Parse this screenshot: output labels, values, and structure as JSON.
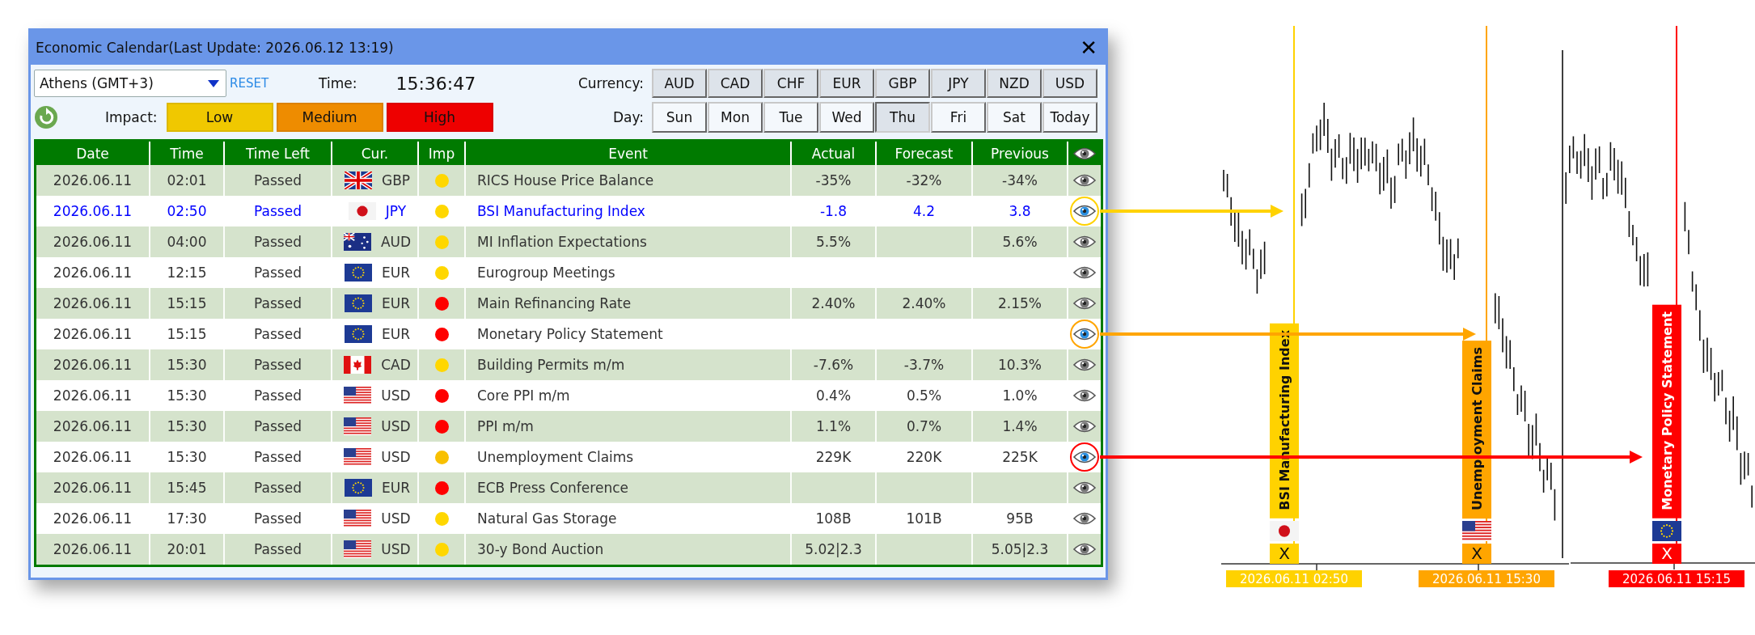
{
  "window": {
    "title": "Economic Calendar(Last Update: 2026.06.12 13:19)",
    "close": "✕"
  },
  "toolbar": {
    "timezone": "Athens (GMT+3)",
    "reset": "RESET",
    "time_label": "Time:",
    "time": "15:36:47",
    "currency_label": "Currency:",
    "currencies": [
      "AUD",
      "CAD",
      "CHF",
      "EUR",
      "GBP",
      "JPY",
      "NZD",
      "USD"
    ],
    "impact_label": "Impact:",
    "impacts": [
      {
        "label": "Low",
        "color": "#f0c800"
      },
      {
        "label": "Medium",
        "color": "#ee8c00"
      },
      {
        "label": "High",
        "color": "#ee0000"
      }
    ],
    "day_label": "Day:",
    "days": [
      {
        "label": "Sun",
        "selected": false
      },
      {
        "label": "Mon",
        "selected": false
      },
      {
        "label": "Tue",
        "selected": false
      },
      {
        "label": "Wed",
        "selected": false
      },
      {
        "label": "Thu",
        "selected": true
      },
      {
        "label": "Fri",
        "selected": false
      },
      {
        "label": "Sat",
        "selected": false
      },
      {
        "label": "Today",
        "selected": false
      }
    ]
  },
  "table": {
    "columns": [
      "Date",
      "Time",
      "Time Left",
      "Cur.",
      "Imp",
      "Event",
      "Actual",
      "Forecast",
      "Previous"
    ],
    "rows": [
      {
        "date": "2026.06.11",
        "time": "02:01",
        "time_left": "Passed",
        "flag": {
          "kind": "uk"
        },
        "currency": "GBP",
        "color": "#ffd700",
        "event": "RICS House Price Balance",
        "actual": "-35%",
        "forecast": "-32%",
        "previous": "-34%",
        "selected": false,
        "watched": false
      },
      {
        "date": "2026.06.11",
        "time": "02:50",
        "time_left": "Passed",
        "flag": {
          "kind": "jp"
        },
        "currency": "JPY",
        "color": "#ffd700",
        "event": "BSI Manufacturing Index",
        "actual": "-1.8",
        "forecast": "4.2",
        "previous": "3.8",
        "selected": true,
        "watched": true
      },
      {
        "date": "2026.06.11",
        "time": "04:00",
        "time_left": "Passed",
        "flag": {
          "kind": "au"
        },
        "currency": "AUD",
        "color": "#ffd700",
        "event": "MI Inflation Expectations",
        "actual": "5.5%",
        "previous": "5.6%",
        "selected": false,
        "watched": false
      },
      {
        "date": "2026.06.11",
        "time": "12:15",
        "time_left": "Passed",
        "flag": {
          "kind": "eu"
        },
        "currency": "EUR",
        "color": "#ffd700",
        "event": "Eurogroup Meetings",
        "selected": false,
        "watched": false
      },
      {
        "date": "2026.06.11",
        "time": "15:15",
        "time_left": "Passed",
        "flag": {
          "kind": "eu"
        },
        "currency": "EUR",
        "color": "#ff0000",
        "event": "Main Refinancing Rate",
        "actual": "2.40%",
        "forecast": "2.40%",
        "previous": "2.15%",
        "selected": false,
        "watched": false
      },
      {
        "date": "2026.06.11",
        "time": "15:15",
        "time_left": "Passed",
        "flag": {
          "kind": "eu"
        },
        "currency": "EUR",
        "color": "#ff0000",
        "event": "Monetary Policy Statement",
        "selected": false,
        "watched": true
      },
      {
        "date": "2026.06.11",
        "time": "15:30",
        "time_left": "Passed",
        "flag": {
          "kind": "ca"
        },
        "currency": "CAD",
        "color": "#ffd700",
        "event": "Building Permits m/m",
        "actual": "-7.6%",
        "forecast": "-3.7%",
        "previous": "10.3%",
        "selected": false,
        "watched": false
      },
      {
        "date": "2026.06.11",
        "time": "15:30",
        "time_left": "Passed",
        "flag": {
          "kind": "us"
        },
        "currency": "USD",
        "color": "#ff0000",
        "event": "Core PPI m/m",
        "actual": "0.4%",
        "forecast": "0.5%",
        "previous": "1.0%",
        "selected": false,
        "watched": false
      },
      {
        "date": "2026.06.11",
        "time": "15:30",
        "time_left": "Passed",
        "flag": {
          "kind": "us"
        },
        "currency": "USD",
        "color": "#ff0000",
        "event": "PPI m/m",
        "actual": "1.1%",
        "forecast": "0.7%",
        "previous": "1.4%",
        "selected": false,
        "watched": false
      },
      {
        "date": "2026.06.11",
        "time": "15:30",
        "time_left": "Passed",
        "flag": {
          "kind": "us"
        },
        "currency": "USD",
        "color": "#f8c000",
        "event": "Unemployment Claims",
        "actual": "229K",
        "forecast": "220K",
        "previous": "225K",
        "selected": false,
        "watched": true
      },
      {
        "date": "2026.06.11",
        "time": "15:45",
        "time_left": "Passed",
        "flag": {
          "kind": "eu"
        },
        "currency": "EUR",
        "color": "#ff0000",
        "event": "ECB Press Conference",
        "selected": false,
        "watched": false
      },
      {
        "date": "2026.06.11",
        "time": "17:30",
        "time_left": "Passed",
        "flag": {
          "kind": "us"
        },
        "currency": "USD",
        "color": "#ffd700",
        "event": "Natural Gas Storage",
        "actual": "108B",
        "forecast": "101B",
        "previous": "95B",
        "selected": false,
        "watched": false
      },
      {
        "date": "2026.06.11",
        "time": "20:01",
        "time_left": "Passed",
        "flag": {
          "kind": "us"
        },
        "currency": "USD",
        "color": "#ffd700",
        "event": "30-y Bond Auction",
        "actual": "5.02|2.3",
        "previous": "5.05|2.3",
        "selected": false,
        "watched": false
      }
    ]
  },
  "chart": {
    "markers": [
      {
        "event": "BSI Manufacturing Index",
        "flag": {
          "kind": "jp"
        },
        "close": "X",
        "date": "2026.06.11 02:50",
        "color": "#ffd200"
      },
      {
        "event": "Unemployment Claims",
        "flag": {
          "kind": "us"
        },
        "close": "X",
        "date": "2026.06.11 15:30",
        "color": "#ffa500"
      },
      {
        "event": "Monetary Policy Statement",
        "flag": {
          "kind": "eu"
        },
        "close": "X",
        "date": "2026.06.11 15:15",
        "color": "#ff0000"
      }
    ]
  }
}
